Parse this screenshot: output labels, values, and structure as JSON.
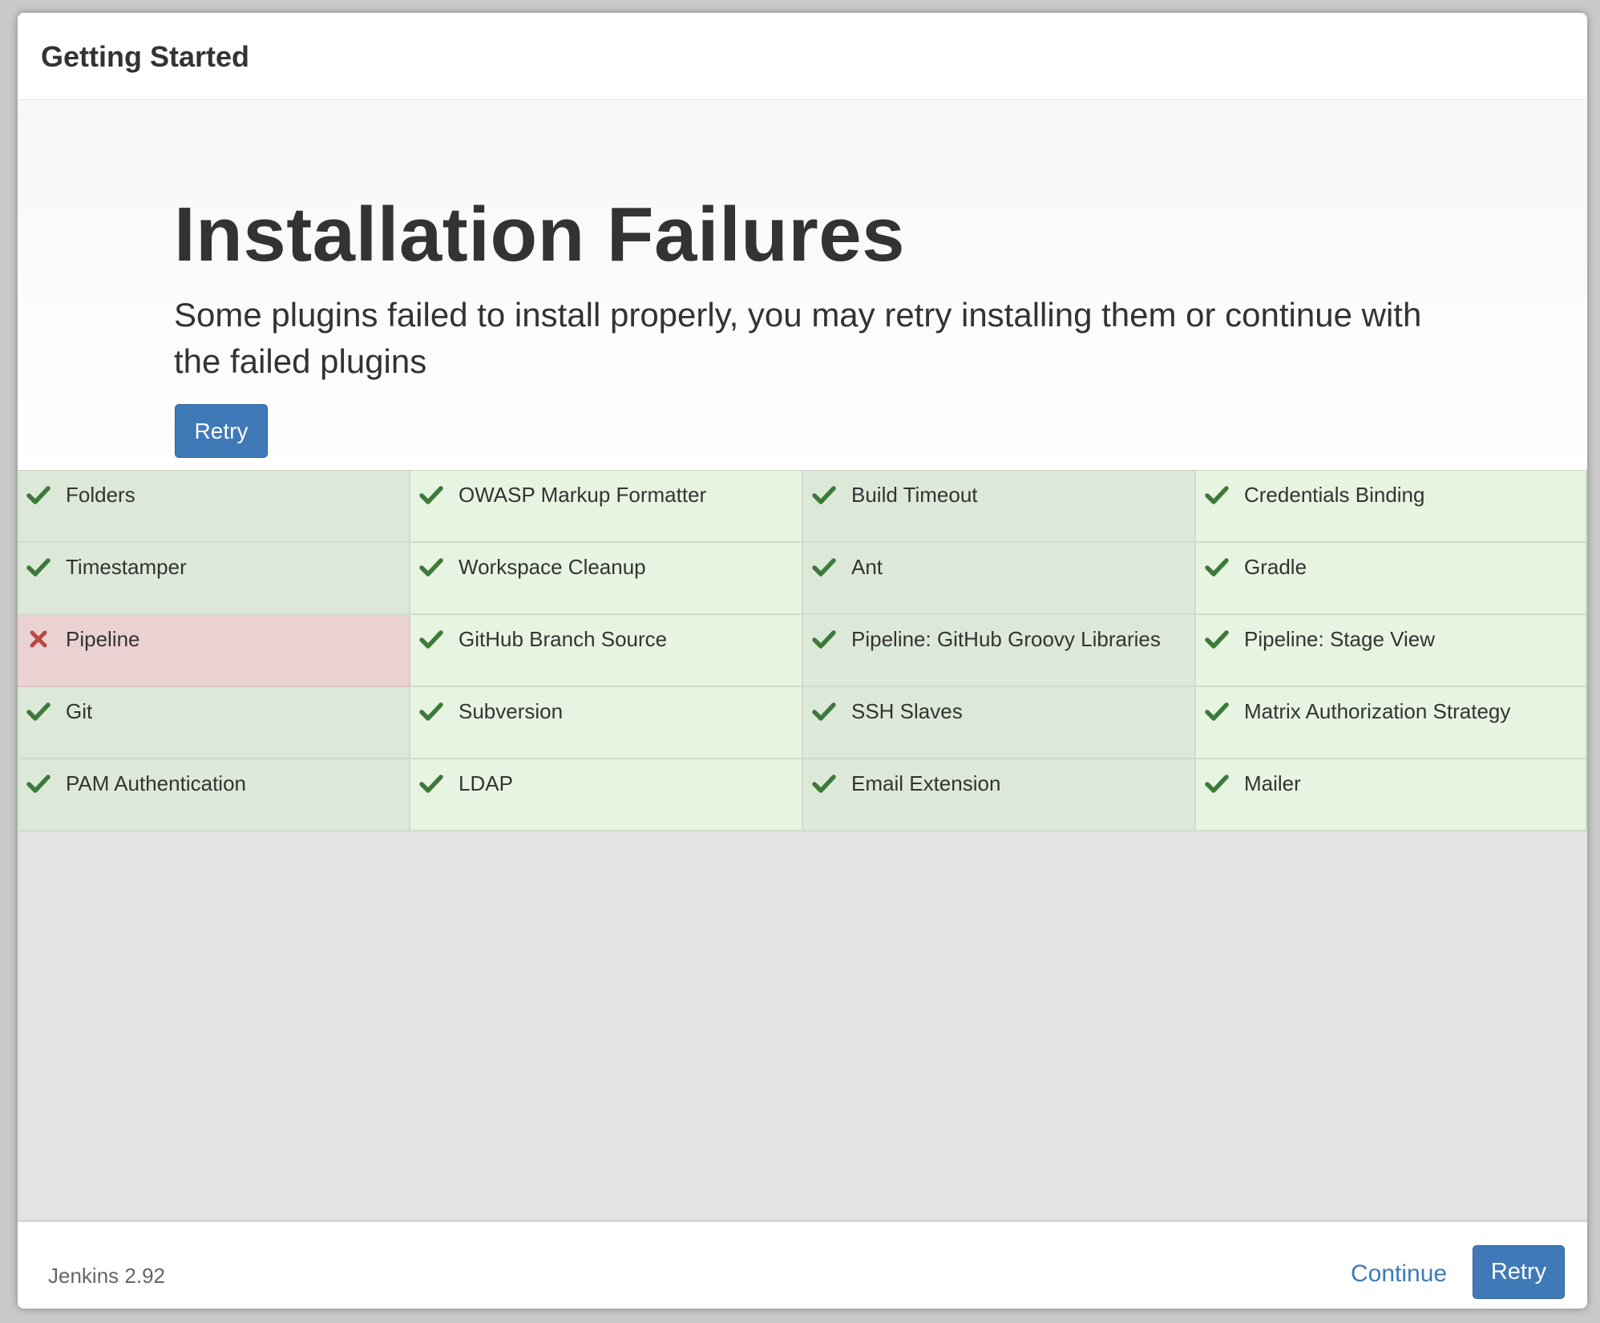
{
  "dialog": {
    "title": "Getting Started"
  },
  "hero": {
    "heading": "Installation Failures",
    "description": "Some plugins failed to install properly, you may retry installing them or continue with the failed plugins",
    "retry_label": "Retry"
  },
  "plugins": [
    {
      "name": "Folders",
      "status": "success"
    },
    {
      "name": "OWASP Markup Formatter",
      "status": "success"
    },
    {
      "name": "Build Timeout",
      "status": "success"
    },
    {
      "name": "Credentials Binding",
      "status": "success"
    },
    {
      "name": "Timestamper",
      "status": "success"
    },
    {
      "name": "Workspace Cleanup",
      "status": "success"
    },
    {
      "name": "Ant",
      "status": "success"
    },
    {
      "name": "Gradle",
      "status": "success"
    },
    {
      "name": "Pipeline",
      "status": "failed"
    },
    {
      "name": "GitHub Branch Source",
      "status": "success"
    },
    {
      "name": "Pipeline: GitHub Groovy Libraries",
      "status": "success"
    },
    {
      "name": "Pipeline: Stage View",
      "status": "success"
    },
    {
      "name": "Git",
      "status": "success"
    },
    {
      "name": "Subversion",
      "status": "success"
    },
    {
      "name": "SSH Slaves",
      "status": "success"
    },
    {
      "name": "Matrix Authorization Strategy",
      "status": "success"
    },
    {
      "name": "PAM Authentication",
      "status": "success"
    },
    {
      "name": "LDAP",
      "status": "success"
    },
    {
      "name": "Email Extension",
      "status": "success"
    },
    {
      "name": "Mailer",
      "status": "success"
    }
  ],
  "icons": {
    "success": "check-icon",
    "failed": "x-icon"
  },
  "colors": {
    "accent": "#3f79b7",
    "success_icon": "#3d7a3a",
    "failed_icon": "#b94846",
    "success_bg": "#e7f4e2",
    "success_bg_alt": "#dce9d8",
    "failed_bg": "#ead2d3"
  },
  "footer": {
    "version": "Jenkins 2.92",
    "continue_label": "Continue",
    "retry_label": "Retry"
  }
}
